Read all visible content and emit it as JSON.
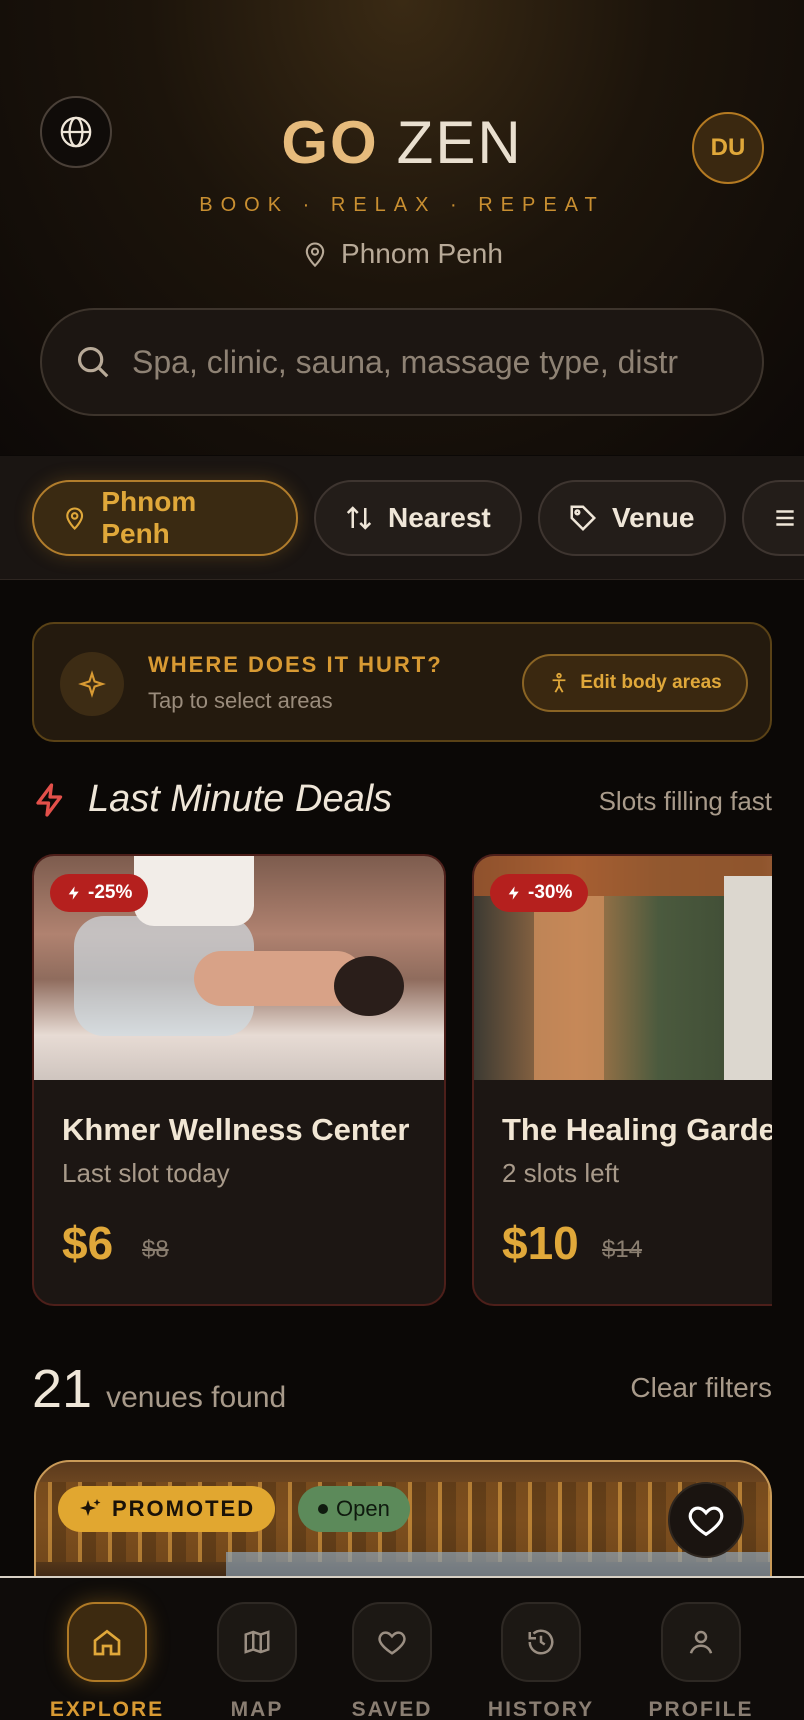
{
  "header": {
    "brand_go": "GO",
    "brand_zen": "ZEN",
    "tagline": "BOOK · RELAX · REPEAT",
    "location": "Phnom Penh",
    "avatar_initials": "DU",
    "globe_icon": "globe-icon"
  },
  "search": {
    "placeholder": "Spa, clinic, sauna, massage type, distr",
    "icon": "search-icon"
  },
  "filters": {
    "chips": [
      {
        "label": "Phnom Penh",
        "icon": "map-pin-icon"
      },
      {
        "label": "Nearest",
        "icon": "sort-icon"
      },
      {
        "label": "Venue",
        "icon": "tag-icon"
      }
    ]
  },
  "body_areas": {
    "title": "WHERE DOES IT HURT?",
    "subtitle": "Tap to select areas",
    "button": "Edit body areas"
  },
  "deals": {
    "title": "Last Minute Deals",
    "subtitle": "Slots filling fast",
    "items": [
      {
        "discount": "-25%",
        "name": "Khmer Wellness Center",
        "slots": "Last slot today",
        "price": "$6",
        "old_price": "$8"
      },
      {
        "discount": "-30%",
        "name": "The Healing Garde",
        "slots": "2 slots left",
        "price": "$10",
        "old_price": "$14"
      }
    ]
  },
  "results": {
    "count": "21",
    "label": "venues found",
    "clear": "Clear filters"
  },
  "venue": {
    "promoted": "PROMOTED",
    "status": "Open"
  },
  "nav": {
    "items": [
      {
        "label": "EXPLORE",
        "icon": "home-icon"
      },
      {
        "label": "MAP",
        "icon": "map-icon"
      },
      {
        "label": "SAVED",
        "icon": "heart-icon"
      },
      {
        "label": "HISTORY",
        "icon": "history-icon"
      },
      {
        "label": "PROFILE",
        "icon": "user-icon"
      }
    ]
  },
  "colors": {
    "accent": "#e0a83a",
    "deal_badge": "#b5201e",
    "open_badge": "#5c8a5a"
  }
}
